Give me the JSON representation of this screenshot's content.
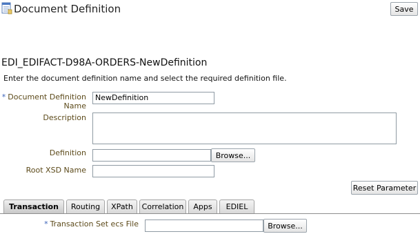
{
  "header": {
    "title": "Document Definition",
    "icon": "document-definition-icon",
    "save_label": "Save"
  },
  "document": {
    "name_heading": "EDI_EDIFACT-D98A-ORDERS-NewDefinition",
    "instructions": "Enter the document definition name and select the required definition file."
  },
  "form": {
    "required_marker": "*",
    "doc_name_label_line1": "Document Definition",
    "doc_name_label_line2": "Name",
    "doc_name_value": "NewDefinition",
    "description_label": "Description",
    "description_value": "",
    "definition_label": "Definition",
    "definition_value": "",
    "browse_label": "Browse...",
    "root_xsd_label": "Root XSD Name",
    "root_xsd_value": "",
    "reset_label": "Reset Parameter"
  },
  "tabs": [
    {
      "label": "Transaction",
      "selected": true
    },
    {
      "label": "Routing",
      "selected": false
    },
    {
      "label": "XPath",
      "selected": false
    },
    {
      "label": "Correlation",
      "selected": false
    },
    {
      "label": "Apps",
      "selected": false
    },
    {
      "label": "EDIEL",
      "selected": false
    }
  ],
  "transaction": {
    "ecs_file_label": "Transaction Set ecs File",
    "ecs_file_value": "",
    "browse_label": "Browse..."
  }
}
